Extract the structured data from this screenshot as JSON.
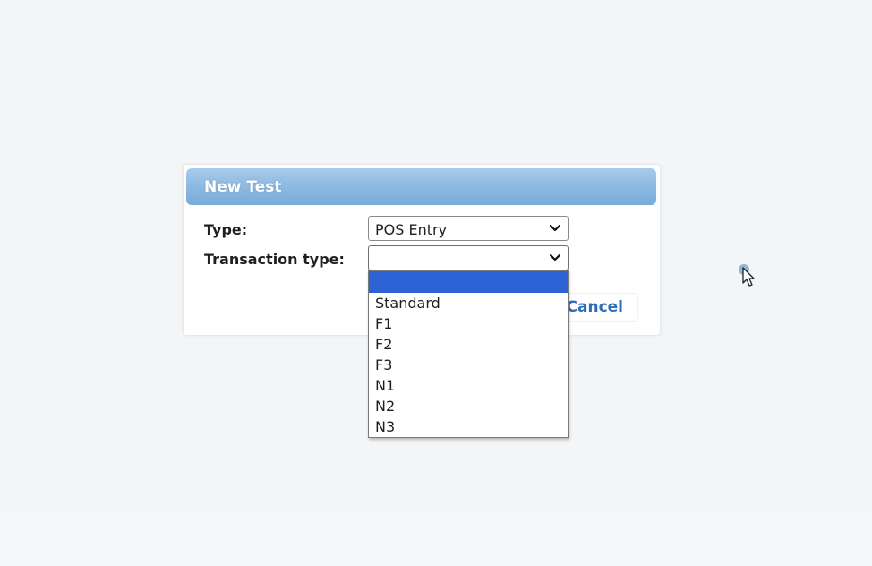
{
  "dialog": {
    "title": "New Test",
    "type_label": "Type:",
    "type_value": "POS Entry",
    "transaction_type_label": "Transaction type:",
    "transaction_type_value": "",
    "cancel_label": "Cancel"
  },
  "dropdown": {
    "options": [
      "",
      "Standard",
      "F1",
      "F2",
      "F3",
      "N1",
      "N2",
      "N3"
    ],
    "highlighted_index": 0
  },
  "colors": {
    "header": "#8fbbe3",
    "highlight": "#2c62d4",
    "link": "#2f6db8"
  }
}
